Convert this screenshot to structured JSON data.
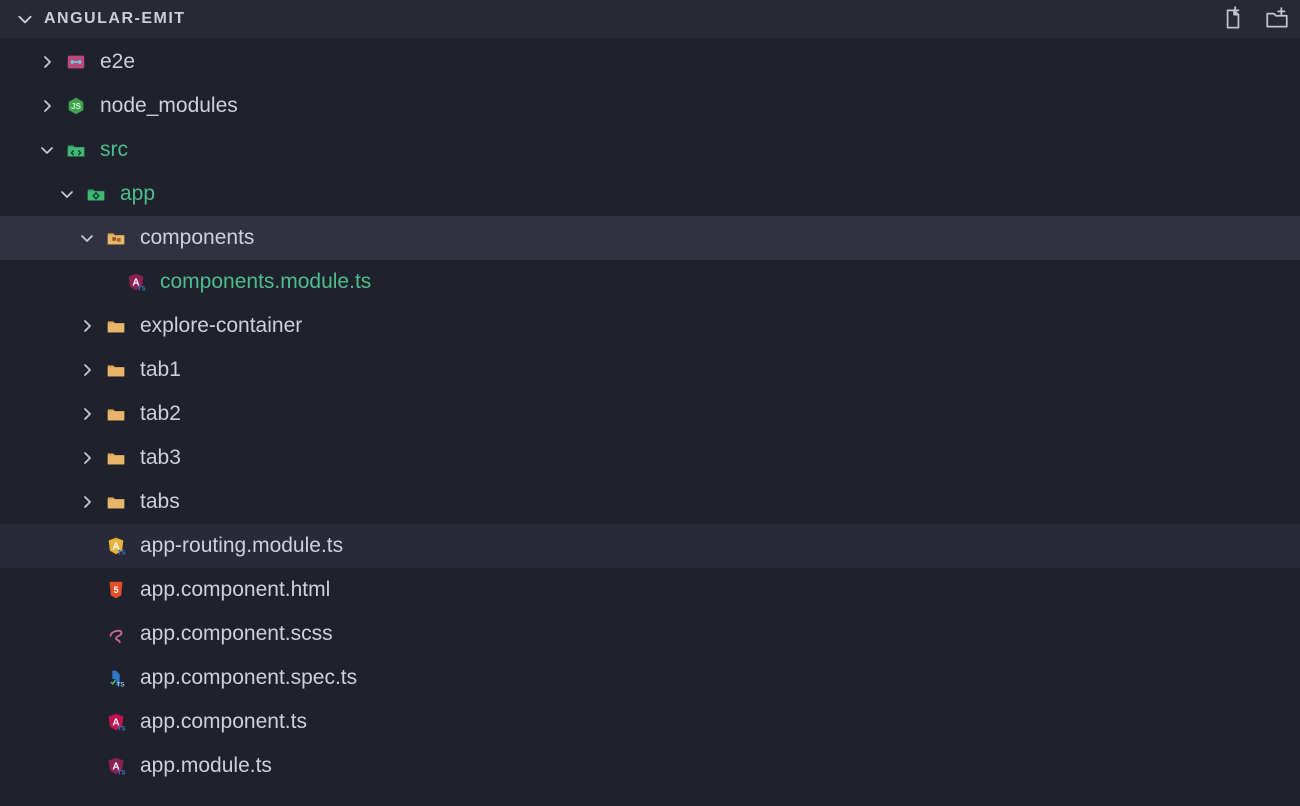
{
  "panel": {
    "title": "ANGULAR-EMIT"
  },
  "tree": [
    {
      "id": "e2e",
      "label": "e2e",
      "depth": 0,
      "kind": "folder-e2e",
      "expanded": false,
      "color": "default"
    },
    {
      "id": "node_modules",
      "label": "node_modules",
      "depth": 0,
      "kind": "folder-node",
      "expanded": false,
      "color": "default"
    },
    {
      "id": "src",
      "label": "src",
      "depth": 0,
      "kind": "folder-src",
      "expanded": true,
      "color": "green"
    },
    {
      "id": "app",
      "label": "app",
      "depth": 1,
      "kind": "folder-app",
      "expanded": true,
      "color": "green"
    },
    {
      "id": "components",
      "label": "components",
      "depth": 2,
      "kind": "folder-components",
      "expanded": true,
      "color": "default",
      "selected": true
    },
    {
      "id": "components-module",
      "label": "components.module.ts",
      "depth": 3,
      "kind": "file-ng-module",
      "expanded": null,
      "color": "green"
    },
    {
      "id": "explore",
      "label": "explore-container",
      "depth": 2,
      "kind": "folder",
      "expanded": false,
      "color": "default"
    },
    {
      "id": "tab1",
      "label": "tab1",
      "depth": 2,
      "kind": "folder",
      "expanded": false,
      "color": "default"
    },
    {
      "id": "tab2",
      "label": "tab2",
      "depth": 2,
      "kind": "folder",
      "expanded": false,
      "color": "default"
    },
    {
      "id": "tab3",
      "label": "tab3",
      "depth": 2,
      "kind": "folder",
      "expanded": false,
      "color": "default"
    },
    {
      "id": "tabs",
      "label": "tabs",
      "depth": 2,
      "kind": "folder",
      "expanded": false,
      "color": "default"
    },
    {
      "id": "app-routing",
      "label": "app-routing.module.ts",
      "depth": 2,
      "kind": "file-ng-routing",
      "expanded": null,
      "color": "default",
      "hover": true
    },
    {
      "id": "app-html",
      "label": "app.component.html",
      "depth": 2,
      "kind": "file-html",
      "expanded": null,
      "color": "default"
    },
    {
      "id": "app-scss",
      "label": "app.component.scss",
      "depth": 2,
      "kind": "file-scss",
      "expanded": null,
      "color": "default"
    },
    {
      "id": "app-spec",
      "label": "app.component.spec.ts",
      "depth": 2,
      "kind": "file-spec",
      "expanded": null,
      "color": "default"
    },
    {
      "id": "app-ts",
      "label": "app.component.ts",
      "depth": 2,
      "kind": "file-ng",
      "expanded": null,
      "color": "default"
    },
    {
      "id": "app-module",
      "label": "app.module.ts",
      "depth": 2,
      "kind": "file-ng-module",
      "expanded": null,
      "color": "default"
    }
  ]
}
